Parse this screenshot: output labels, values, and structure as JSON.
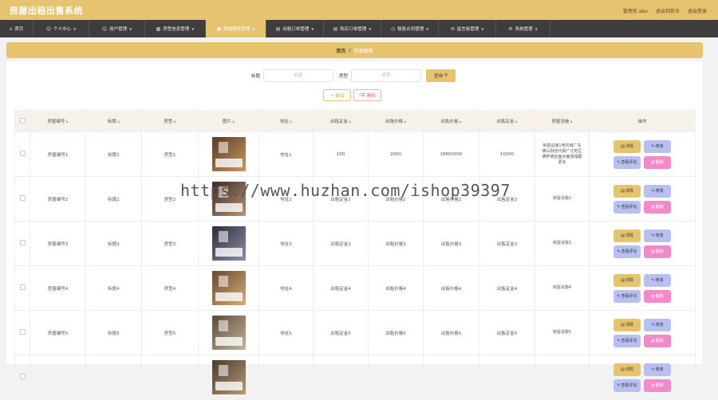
{
  "app": {
    "title": "房屋出租出售系统",
    "top_right": [
      "管理员 abo",
      "退出到前台",
      "退出登录"
    ]
  },
  "nav": [
    {
      "label": "首页",
      "icon": "home-icon",
      "has_caret": false,
      "active": false
    },
    {
      "label": "个人中心",
      "icon": "user-icon",
      "has_caret": true,
      "active": false
    },
    {
      "label": "用户管理",
      "icon": "user-icon",
      "has_caret": true,
      "active": false
    },
    {
      "label": "房型信息管理",
      "icon": "grid-icon",
      "has_caret": true,
      "active": false
    },
    {
      "label": "房屋租售管理",
      "icon": "grid-icon",
      "has_caret": true,
      "active": true
    },
    {
      "label": "出租订单管理",
      "icon": "order-icon",
      "has_caret": true,
      "active": false
    },
    {
      "label": "购买订单管理",
      "icon": "order-icon",
      "has_caret": true,
      "active": false
    },
    {
      "label": "租售合同管理",
      "icon": "clock-icon",
      "has_caret": true,
      "active": false
    },
    {
      "label": "留言板管理",
      "icon": "message-icon",
      "has_caret": true,
      "active": false
    },
    {
      "label": "系统管理",
      "icon": "gear-icon",
      "has_caret": true,
      "active": false
    }
  ],
  "breadcrumb": {
    "home": "首页",
    "sep": "/",
    "current": "房屋租售"
  },
  "search": {
    "title_label": "标题",
    "title_placeholder": "标题",
    "type_label": "房型",
    "type_placeholder": "房型",
    "button": "查询"
  },
  "actions": {
    "add": "新增",
    "delete": "删除"
  },
  "table": {
    "headers": [
      "房屋编号",
      "标题",
      "房型",
      "图片",
      "地址",
      "出租定金",
      "出租价格",
      "出售价格",
      "出售定金",
      "房屋设施",
      "操作"
    ],
    "rows": [
      {
        "no": "房屋编号1",
        "title": "标题1",
        "type": "房型1",
        "address": "地址1",
        "rent_deposit": "100",
        "rent_price": "2000",
        "sale_price": "18800000",
        "sale_deposit": "10000",
        "facilities": "房屋设施1电风扇广东佛山融创代融广泛地区佛萨德后面对面接壤跟更多"
      },
      {
        "no": "房屋编号2",
        "title": "标题2",
        "type": "房型2",
        "address": "地址2",
        "rent_deposit": "出租定金2",
        "rent_price": "出租价格2",
        "sale_price": "出售价格2",
        "sale_deposit": "出售定金2",
        "facilities": "房屋设施2"
      },
      {
        "no": "房屋编号3",
        "title": "标题3",
        "type": "房型3",
        "address": "地址3",
        "rent_deposit": "出租定金3",
        "rent_price": "出租价格3",
        "sale_price": "出售价格3",
        "sale_deposit": "出售定金3",
        "facilities": "房屋设施3"
      },
      {
        "no": "房屋编号4",
        "title": "标题4",
        "type": "房型4",
        "address": "地址4",
        "rent_deposit": "出租定金4",
        "rent_price": "出租价格4",
        "sale_price": "出售价格4",
        "sale_deposit": "出售定金4",
        "facilities": "房屋设施4"
      },
      {
        "no": "房屋编号5",
        "title": "标题5",
        "type": "房型5",
        "address": "地址5",
        "rent_deposit": "出租定金5",
        "rent_price": "出租价格5",
        "sale_price": "出售价格5",
        "sale_deposit": "出售定金5",
        "facilities": "房屋设施5"
      },
      {
        "no": "",
        "title": "",
        "type": "",
        "address": "",
        "rent_deposit": "",
        "rent_price": "",
        "sale_price": "",
        "sale_deposit": "",
        "facilities": ""
      }
    ],
    "row_buttons": {
      "detail": "详情",
      "edit": "修改",
      "review": "查看评论",
      "remove": "删除"
    }
  },
  "watermark": "https://www.huzhan.com/ishop39397",
  "colors": {
    "accent": "#e6c36f",
    "nav_bg": "#3d3d3d",
    "edit_btn": "#b7c0f0",
    "delete_btn": "#f08ac8"
  }
}
